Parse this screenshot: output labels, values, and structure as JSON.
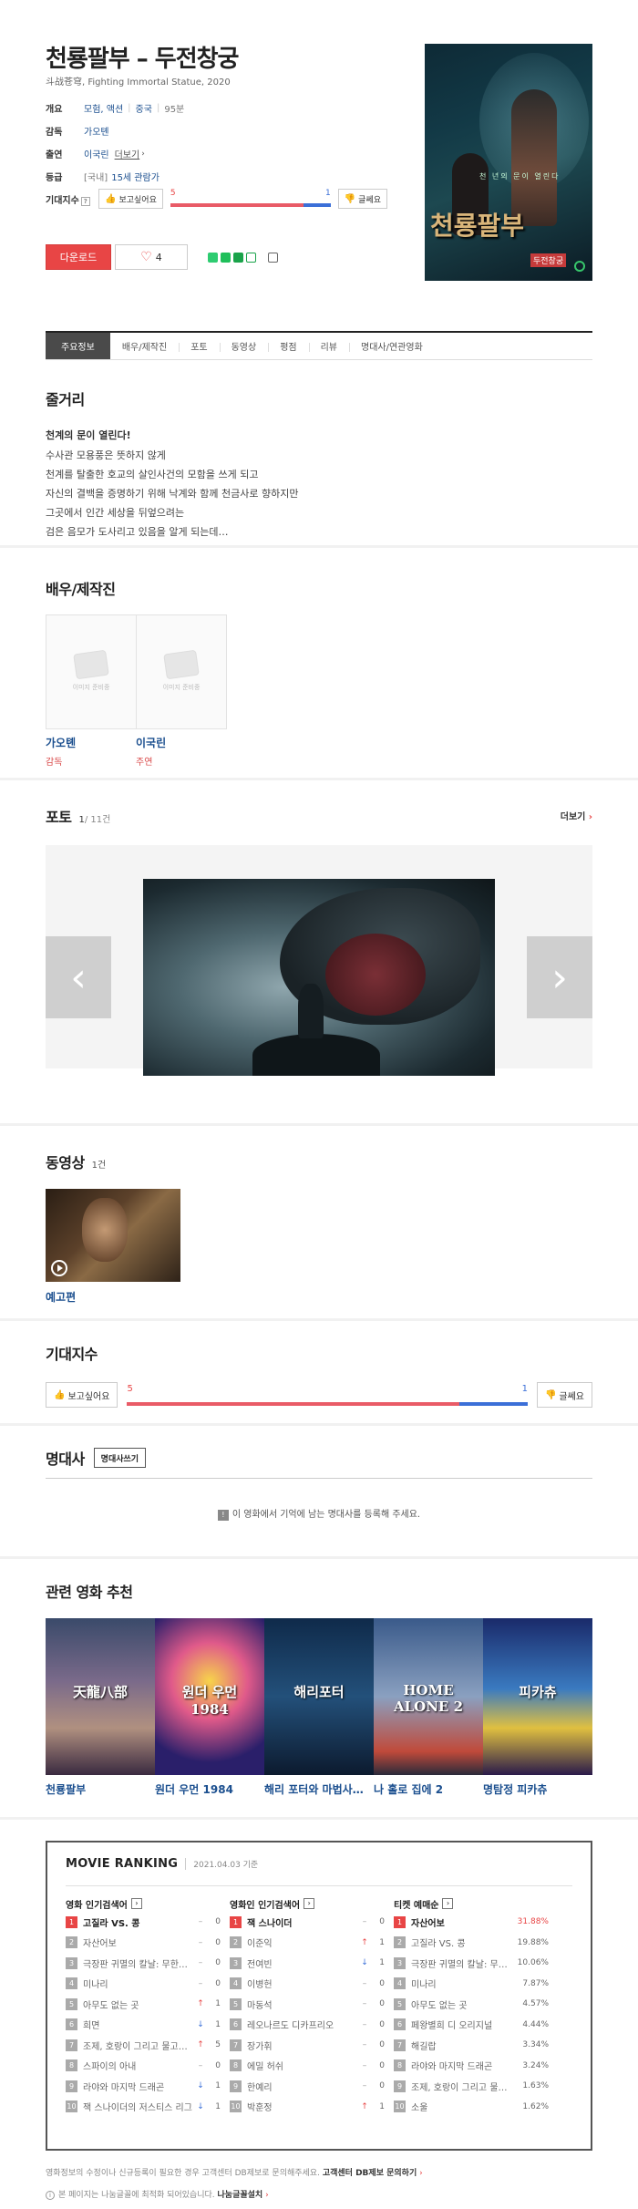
{
  "movie": {
    "title": "천룡팔부 – 두전창궁",
    "subtitle": "斗战苍穹, Fighting Immortal Statue, 2020",
    "info": {
      "genre_label": "개요",
      "genre": "모험, 액션",
      "country": "중국",
      "runtime": "95분",
      "director_label": "감독",
      "director": "가오톈",
      "cast_label": "출연",
      "cast": "이국린",
      "cast_more": "더보기",
      "rating_label": "등급",
      "rating_country": "[국내]",
      "rating": "15세 관람가"
    },
    "poster": {
      "title_text": "천룡팔부",
      "badge": "두전창궁",
      "caption": "천 년의 문이 열린다"
    }
  },
  "expectation": {
    "label": "기대지수",
    "help": "?",
    "want_label": "보고싶어요",
    "meh_label": "글쎄요",
    "want_count": "5",
    "meh_count": "1",
    "want_ratio": 0.83
  },
  "actions": {
    "download": "다운로드",
    "likes": "4"
  },
  "tabs": [
    "주요정보",
    "배우/제작진",
    "포토",
    "동영상",
    "평점",
    "리뷰",
    "명대사/연관영화"
  ],
  "synopsis": {
    "title": "줄거리",
    "tagline": "천계의 문이 열린다!",
    "lines": [
      "수사관 모용풍은 뜻하지 않게",
      "천계를 탈출한 호교의 살인사건의 모함을 쓰게 되고",
      "자신의 결백을 증명하기 위해 낙계와 함께 천금사로 향하지만",
      "그곳에서 인간 세상을 뒤엎으려는",
      "검은 음모가 도사리고 있음을 알게 되는데…"
    ]
  },
  "cast_section": {
    "title": "배우/제작진",
    "no_image": "이미지 준비중",
    "people": [
      {
        "name": "가오톈",
        "role": "감독"
      },
      {
        "name": "이국린",
        "role": "주연"
      }
    ]
  },
  "photo": {
    "title": "포토",
    "current": "1",
    "total": "/ 11건",
    "more": "더보기",
    "prev": "‹",
    "next": "›"
  },
  "video": {
    "title": "동영상",
    "count": "1건",
    "item": "예고편"
  },
  "expectation2": {
    "title": "기대지수"
  },
  "quotes": {
    "title": "명대사",
    "write": "명대사쓰기",
    "empty_icon": "!",
    "empty": "이 영화에서 기억에 남는 명대사를 등록해 주세요."
  },
  "related": {
    "title": "관련 영화 추천",
    "items": [
      {
        "title": "천룡팔부",
        "cap": "天龍八部"
      },
      {
        "title": "원더 우먼 1984",
        "cap": "원더 우먼 1984"
      },
      {
        "title": "해리 포터와 마법사의 돌",
        "cap": "해리포터"
      },
      {
        "title": "나 홀로 집에 2",
        "cap": "HOME ALONE 2"
      },
      {
        "title": "명탐정 피카츄",
        "cap": "피카츄"
      }
    ]
  },
  "ranking": {
    "title": "MOVIE RANKING",
    "date": "2021.04.03 기준",
    "go": "›",
    "columns": [
      {
        "header": "영화 인기검색어",
        "rows": [
          {
            "n": "1",
            "name": "고질라 VS. 콩",
            "dir": "flat",
            "arrow": "–",
            "change": "0"
          },
          {
            "n": "2",
            "name": "자산어보",
            "dir": "flat",
            "arrow": "–",
            "change": "0"
          },
          {
            "n": "3",
            "name": "극장판 귀멸의 칼날: 무한열차편",
            "dir": "flat",
            "arrow": "–",
            "change": "0"
          },
          {
            "n": "4",
            "name": "미나리",
            "dir": "flat",
            "arrow": "–",
            "change": "0"
          },
          {
            "n": "5",
            "name": "아무도 없는 곳",
            "dir": "up",
            "arrow": "↑",
            "change": "1"
          },
          {
            "n": "6",
            "name": "희면",
            "dir": "down",
            "arrow": "↓",
            "change": "1"
          },
          {
            "n": "7",
            "name": "조제, 호랑이 그리고 물고기들",
            "dir": "up",
            "arrow": "↑",
            "change": "5"
          },
          {
            "n": "8",
            "name": "스파이의 아내",
            "dir": "flat",
            "arrow": "–",
            "change": "0"
          },
          {
            "n": "9",
            "name": "라야와 마지막 드래곤",
            "dir": "down",
            "arrow": "↓",
            "change": "1"
          },
          {
            "n": "10",
            "name": "잭 스나이더의 저스티스 리그",
            "dir": "down",
            "arrow": "↓",
            "change": "1"
          }
        ]
      },
      {
        "header": "영화인 인기검색어",
        "rows": [
          {
            "n": "1",
            "name": "잭 스나이더",
            "dir": "flat",
            "arrow": "–",
            "change": "0"
          },
          {
            "n": "2",
            "name": "이준익",
            "dir": "up",
            "arrow": "↑",
            "change": "1"
          },
          {
            "n": "3",
            "name": "전여빈",
            "dir": "down",
            "arrow": "↓",
            "change": "1"
          },
          {
            "n": "4",
            "name": "이병헌",
            "dir": "flat",
            "arrow": "–",
            "change": "0"
          },
          {
            "n": "5",
            "name": "마동석",
            "dir": "flat",
            "arrow": "–",
            "change": "0"
          },
          {
            "n": "6",
            "name": "레오나르도 디카프리오",
            "dir": "flat",
            "arrow": "–",
            "change": "0"
          },
          {
            "n": "7",
            "name": "장가휘",
            "dir": "flat",
            "arrow": "–",
            "change": "0"
          },
          {
            "n": "8",
            "name": "에밀 허쉬",
            "dir": "flat",
            "arrow": "–",
            "change": "0"
          },
          {
            "n": "9",
            "name": "한예리",
            "dir": "flat",
            "arrow": "–",
            "change": "0"
          },
          {
            "n": "10",
            "name": "박훈정",
            "dir": "up",
            "arrow": "↑",
            "change": "1"
          }
        ]
      },
      {
        "header": "티켓 예매순",
        "rows": [
          {
            "n": "1",
            "name": "자산어보",
            "pct": "31.88%"
          },
          {
            "n": "2",
            "name": "고질라 VS. 콩",
            "pct": "19.88%"
          },
          {
            "n": "3",
            "name": "극장판 귀멸의 칼날: 무한열차편",
            "pct": "10.06%"
          },
          {
            "n": "4",
            "name": "미나리",
            "pct": "7.87%"
          },
          {
            "n": "5",
            "name": "아무도 없는 곳",
            "pct": "4.57%"
          },
          {
            "n": "6",
            "name": "페왕별희 디 오리지널",
            "pct": "4.44%"
          },
          {
            "n": "7",
            "name": "해길랍",
            "pct": "3.34%"
          },
          {
            "n": "8",
            "name": "라야와 마지막 드래곤",
            "pct": "3.24%"
          },
          {
            "n": "9",
            "name": "조제, 호랑이 그리고 물고기들",
            "pct": "1.63%"
          },
          {
            "n": "10",
            "name": "소울",
            "pct": "1.62%"
          }
        ]
      }
    ]
  },
  "footer": {
    "notice": "영화정보의 수정이나 신규등록이 필요한 경우 고객센터 DB제보로 문의해주세요.",
    "db_link": "고객센터 DB제보 문의하기",
    "font_icon": "i",
    "font_notice": "본 페이지는 나눔글꼴에 최적화 되어있습니다.",
    "font_link": "나눔글꼴설치"
  }
}
